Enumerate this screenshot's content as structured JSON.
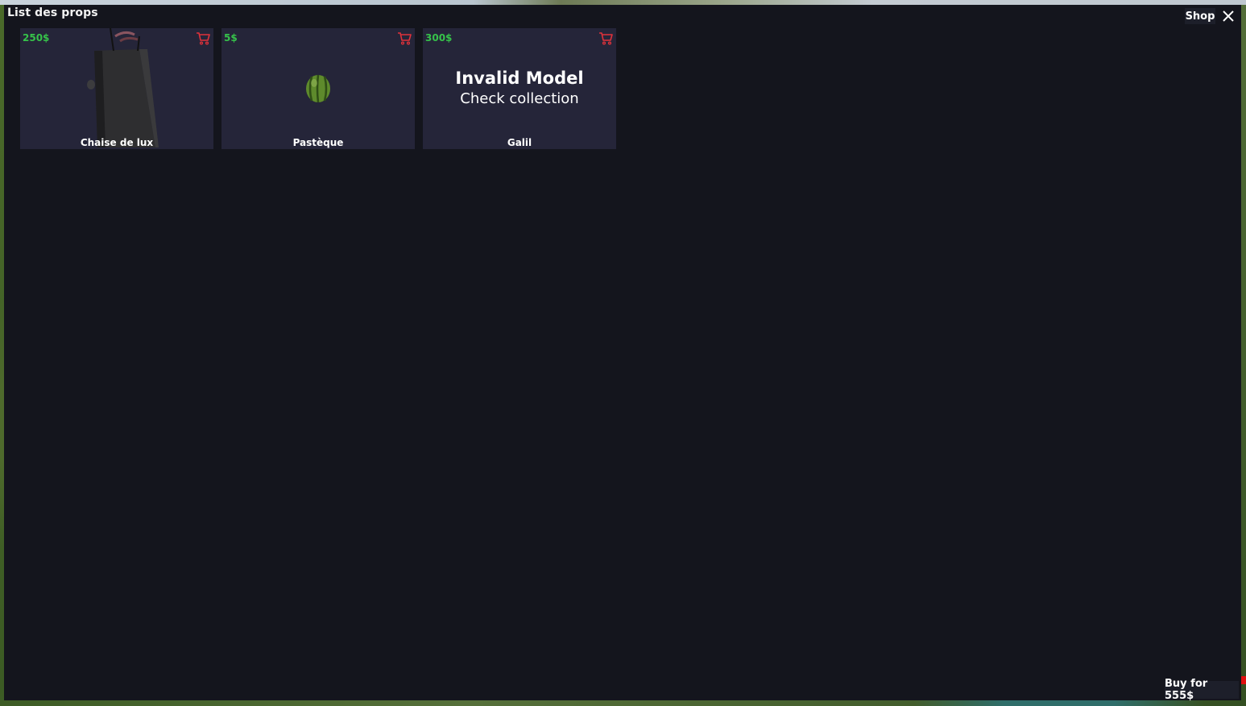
{
  "window": {
    "title": "List des props",
    "shop_label": "Shop"
  },
  "items": [
    {
      "price": "250$",
      "name": "Chaise de lux",
      "model": "chair-image",
      "cart_icon": "cart-icon"
    },
    {
      "price": "5$",
      "name": "Pastèque",
      "model": "watermelon-image",
      "cart_icon": "cart-icon"
    },
    {
      "price": "300$",
      "name": "Galil",
      "model": "invalid",
      "invalid_title": "Invalid Model",
      "invalid_sub": "Check collection",
      "cart_icon": "cart-icon"
    }
  ],
  "footer": {
    "buy_label": "Buy for 555$"
  },
  "colors": {
    "panel_bg": "#14151d",
    "card_bg": "#252539",
    "price": "#36c24a",
    "cart": "#e0323a"
  }
}
